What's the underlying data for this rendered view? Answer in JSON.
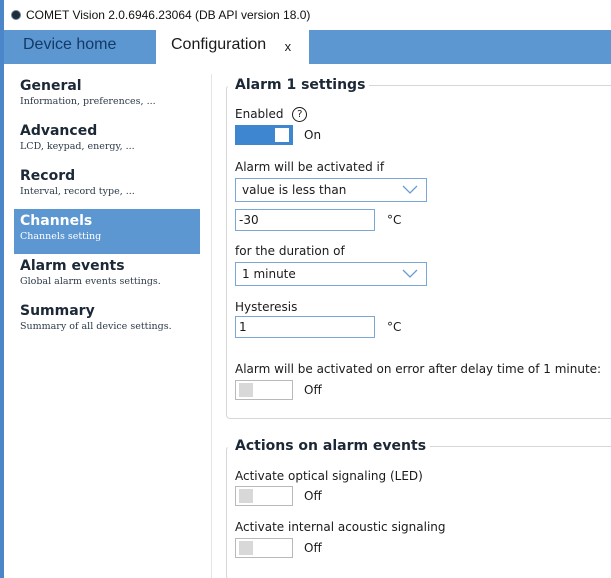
{
  "window": {
    "title": "COMET Vision 2.0.6946.23064 (DB API version 18.0)"
  },
  "tabs": [
    {
      "label": "Device home"
    },
    {
      "label": "Configuration",
      "close": "x"
    }
  ],
  "sidebar": {
    "items": [
      {
        "title": "General",
        "subtitle": "Information, preferences, ..."
      },
      {
        "title": "Advanced",
        "subtitle": "LCD, keypad, energy, ..."
      },
      {
        "title": "Record",
        "subtitle": "Interval, record type, ..."
      },
      {
        "title": "Channels",
        "subtitle": "Channels setting",
        "active": true
      },
      {
        "title": "Alarm events",
        "subtitle": "Global alarm events settings."
      },
      {
        "title": "Summary",
        "subtitle": "Summary of all device settings."
      }
    ]
  },
  "alarm_settings": {
    "heading": "Alarm 1 settings",
    "enabled": {
      "label": "Enabled",
      "help": "?",
      "state": "On"
    },
    "condition": {
      "label": "Alarm will be activated if",
      "selected": "value is less than"
    },
    "limit": {
      "value": "-30",
      "unit": "°C"
    },
    "duration": {
      "label": "for the duration of",
      "selected": "1 minute"
    },
    "hysteresis": {
      "label": "Hysteresis",
      "value": "1",
      "unit": "°C"
    },
    "error_activation": {
      "label": "Alarm will be activated on error after delay time of 1 minute:",
      "state": "Off"
    }
  },
  "actions": {
    "heading": "Actions on alarm events",
    "optical": {
      "label": "Activate optical signaling (LED)",
      "state": "Off"
    },
    "acoustic": {
      "label": "Activate internal acoustic signaling",
      "state": "Off"
    }
  },
  "colors": {
    "accent": "#5d97d2",
    "toggle_on": "#3f86d0",
    "input_border": "#7aa6d8"
  }
}
